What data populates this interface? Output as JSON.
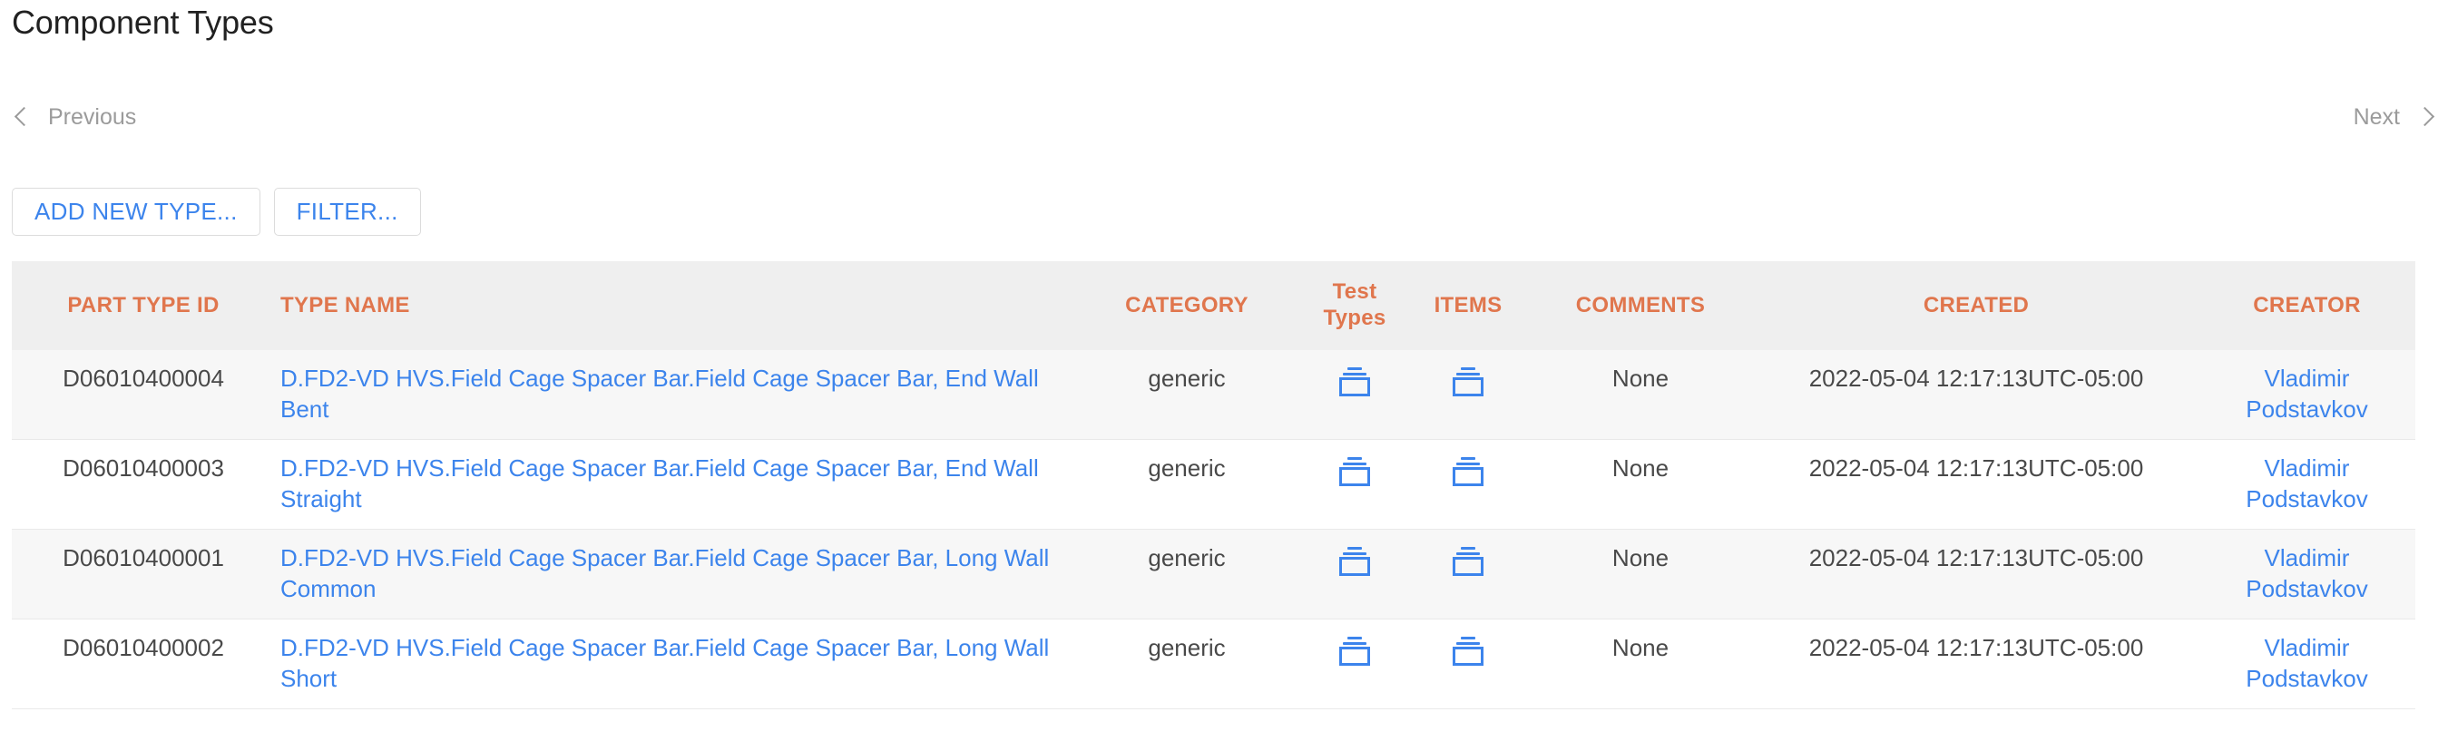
{
  "page": {
    "title": "Component Types"
  },
  "pager": {
    "previous_label": "Previous",
    "next_label": "Next",
    "previous_icon": "chevron-left-icon",
    "next_icon": "chevron-right-icon"
  },
  "toolbar": {
    "add_new_type_label": "ADD NEW TYPE...",
    "filter_label": "FILTER..."
  },
  "table": {
    "columns": [
      {
        "key": "part_type_id",
        "label": "PART TYPE ID"
      },
      {
        "key": "type_name",
        "label": "TYPE NAME"
      },
      {
        "key": "category",
        "label": "CATEGORY"
      },
      {
        "key": "test_types",
        "label": "Test Types"
      },
      {
        "key": "items",
        "label": "ITEMS"
      },
      {
        "key": "comments",
        "label": "COMMENTS"
      },
      {
        "key": "created",
        "label": "CREATED"
      },
      {
        "key": "creator",
        "label": "CREATOR"
      }
    ],
    "rows": [
      {
        "part_type_id": "D06010400004",
        "type_name": "D.FD2-VD HVS.Field Cage Spacer Bar.Field Cage Spacer Bar, End Wall Bent",
        "category": "generic",
        "test_types_icon": "stacked-boxes-icon",
        "items_icon": "stacked-boxes-icon",
        "comments": "None",
        "created": "2022-05-04 12:17:13UTC-05:00",
        "creator": "Vladimir Podstavkov"
      },
      {
        "part_type_id": "D06010400003",
        "type_name": "D.FD2-VD HVS.Field Cage Spacer Bar.Field Cage Spacer Bar, End Wall Straight",
        "category": "generic",
        "test_types_icon": "stacked-boxes-icon",
        "items_icon": "stacked-boxes-icon",
        "comments": "None",
        "created": "2022-05-04 12:17:13UTC-05:00",
        "creator": "Vladimir Podstavkov"
      },
      {
        "part_type_id": "D06010400001",
        "type_name": "D.FD2-VD HVS.Field Cage Spacer Bar.Field Cage Spacer Bar, Long Wall Common",
        "category": "generic",
        "test_types_icon": "stacked-boxes-icon",
        "items_icon": "stacked-boxes-icon",
        "comments": "None",
        "created": "2022-05-04 12:17:13UTC-05:00",
        "creator": "Vladimir Podstavkov"
      },
      {
        "part_type_id": "D06010400002",
        "type_name": "D.FD2-VD HVS.Field Cage Spacer Bar.Field Cage Spacer Bar, Long Wall Short",
        "category": "generic",
        "test_types_icon": "stacked-boxes-icon",
        "items_icon": "stacked-boxes-icon",
        "comments": "None",
        "created": "2022-05-04 12:17:13UTC-05:00",
        "creator": "Vladimir Podstavkov"
      }
    ]
  },
  "colors": {
    "header_text": "#e0764d",
    "link": "#3c84ec",
    "title_text": "#212121",
    "body_text": "#494949",
    "pager_text": "#9b9b9b",
    "header_bg": "#efefef",
    "row_alt_bg": "#f7f7f7",
    "row_border": "#e9e9e9",
    "button_border": "#dcdcdc"
  }
}
